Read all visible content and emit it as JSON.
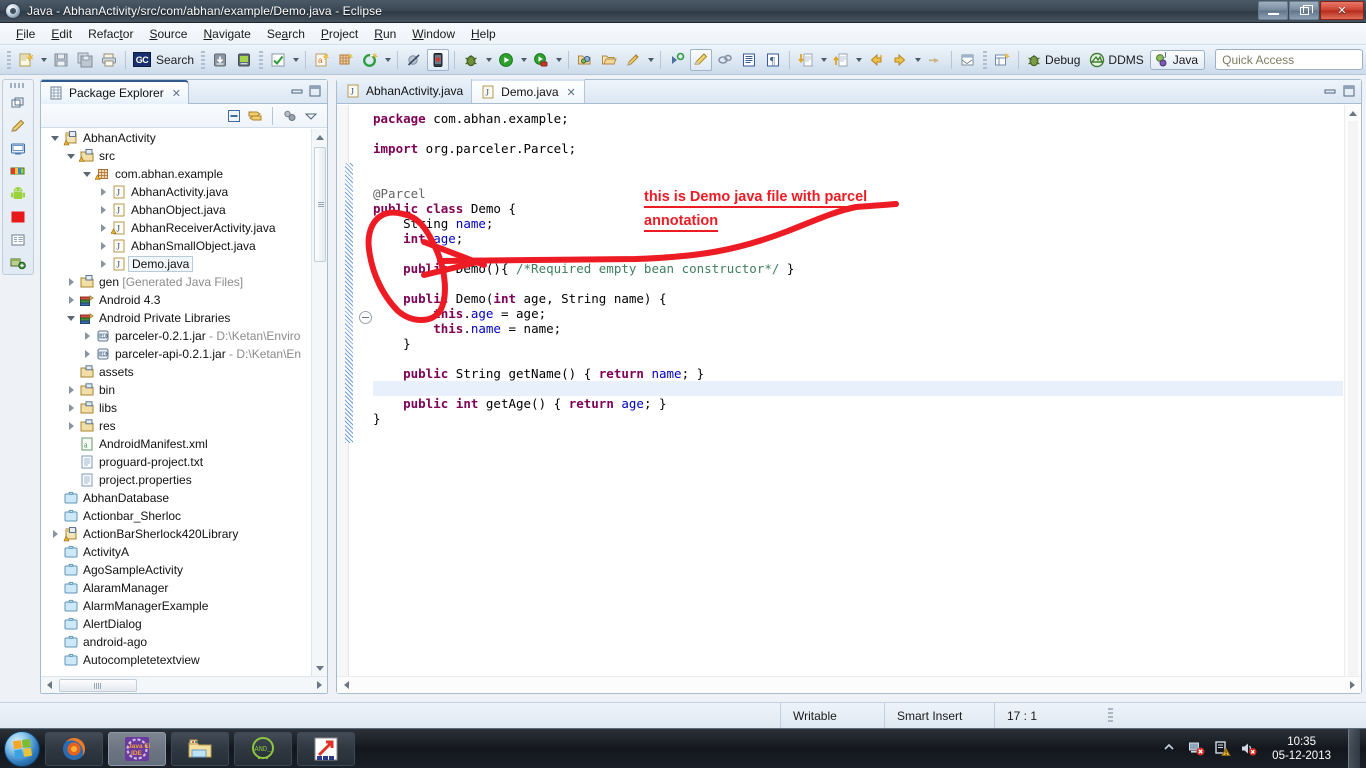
{
  "window": {
    "title": "Java - AbhanActivity/src/com/abhan/example/Demo.java - Eclipse",
    "icon": "eclipse-icon",
    "minimize_label": "Minimize",
    "restore_label": "Restore",
    "close_label": "Close"
  },
  "menubar": {
    "items": [
      {
        "label": "File",
        "mnemonic": "F"
      },
      {
        "label": "Edit",
        "mnemonic": "E"
      },
      {
        "label": "Refactor",
        "mnemonic": "t"
      },
      {
        "label": "Source",
        "mnemonic": "S"
      },
      {
        "label": "Navigate",
        "mnemonic": "N"
      },
      {
        "label": "Search",
        "mnemonic": "a"
      },
      {
        "label": "Project",
        "mnemonic": "P"
      },
      {
        "label": "Run",
        "mnemonic": "R"
      },
      {
        "label": "Window",
        "mnemonic": "W"
      },
      {
        "label": "Help",
        "mnemonic": "H"
      }
    ]
  },
  "toolbar": {
    "search_label": "Search",
    "gc_badge": "GC",
    "items": [
      {
        "name": "new-wizard-icon"
      },
      {
        "name": "save-icon"
      },
      {
        "name": "save-all-icon"
      },
      {
        "name": "print-icon"
      },
      {
        "name": "gc-icon"
      },
      {
        "name": "android-download-icon"
      },
      {
        "name": "android-sdk-manager-icon"
      },
      {
        "name": "check-icon"
      },
      {
        "name": "new-android-project-icon"
      },
      {
        "name": "new-android-xml-icon"
      },
      {
        "name": "new-icon"
      },
      {
        "name": "skip-breakpoints-icon"
      },
      {
        "name": "device-icon"
      },
      {
        "name": "debug-icon"
      },
      {
        "name": "run-icon"
      },
      {
        "name": "run-external-icon"
      },
      {
        "name": "open-type-icon"
      },
      {
        "name": "open-task-icon"
      },
      {
        "name": "marker-icon"
      },
      {
        "name": "next-annotation-icon"
      },
      {
        "name": "toggle-mark-occurrences-icon"
      },
      {
        "name": "link-icon"
      },
      {
        "name": "show-whitespace-icon"
      },
      {
        "name": "pilcrow-icon"
      },
      {
        "name": "next-edit-position-icon"
      },
      {
        "name": "previous-edit-position-icon"
      },
      {
        "name": "back-icon"
      },
      {
        "name": "forward-icon"
      },
      {
        "name": "new-window-icon"
      }
    ]
  },
  "perspectives": {
    "open_label": "Open Perspective",
    "items": [
      {
        "label": "Debug",
        "icon": "debug-perspective-icon",
        "active": false
      },
      {
        "label": "DDMS",
        "icon": "ddms-perspective-icon",
        "active": false
      },
      {
        "label": "Java",
        "icon": "java-perspective-icon",
        "active": true
      }
    ]
  },
  "quick_access": {
    "placeholder": "Quick Access",
    "value": ""
  },
  "fastbar": {
    "items": [
      {
        "name": "restore-icon"
      },
      {
        "name": "pen-icon"
      },
      {
        "name": "console-icon"
      },
      {
        "name": "logcat-icon"
      },
      {
        "name": "android-icon"
      },
      {
        "name": "stop-icon"
      },
      {
        "name": "outline-icon"
      },
      {
        "name": "package-explorer-icon"
      }
    ]
  },
  "package_explorer": {
    "tab_label": "Package Explorer",
    "tab_icon": "package-explorer-icon",
    "close_label": "Close",
    "toolbar": [
      {
        "name": "collapse-all-icon"
      },
      {
        "name": "link-with-editor-icon"
      },
      {
        "name": "focus-on-active-task-icon"
      },
      {
        "name": "view-menu-icon"
      }
    ],
    "minimize_label": "Minimize",
    "maximize_label": "Maximize",
    "tree": [
      {
        "label": "AbhanActivity",
        "indent": 0,
        "twisty": "open",
        "icon": "java-project-warning-icon",
        "selected": false
      },
      {
        "label": "src",
        "indent": 1,
        "twisty": "open",
        "icon": "source-folder-warning-icon",
        "selected": false
      },
      {
        "label": "com.abhan.example",
        "indent": 2,
        "twisty": "open",
        "icon": "package-warning-icon",
        "selected": false
      },
      {
        "label": "AbhanActivity.java",
        "indent": 3,
        "twisty": "closed",
        "icon": "java-file-icon",
        "selected": false
      },
      {
        "label": "AbhanObject.java",
        "indent": 3,
        "twisty": "closed",
        "icon": "java-file-icon",
        "selected": false
      },
      {
        "label": "AbhanReceiverActivity.java",
        "indent": 3,
        "twisty": "closed",
        "icon": "java-file-warning-icon",
        "selected": false
      },
      {
        "label": "AbhanSmallObject.java",
        "indent": 3,
        "twisty": "closed",
        "icon": "java-file-icon",
        "selected": false
      },
      {
        "label": "Demo.java",
        "indent": 3,
        "twisty": "closed",
        "icon": "java-file-icon",
        "selected": true
      },
      {
        "label": "gen",
        "sublabel": " [Generated Java Files]",
        "indent": 1,
        "twisty": "closed",
        "icon": "source-folder-icon",
        "selected": false
      },
      {
        "label": "Android 4.3",
        "indent": 1,
        "twisty": "closed",
        "icon": "library-icon",
        "selected": false
      },
      {
        "label": "Android Private Libraries",
        "indent": 1,
        "twisty": "open",
        "icon": "library-icon",
        "selected": false
      },
      {
        "label": "parceler-0.2.1.jar",
        "sublabel": " - D:\\Ketan\\Enviro",
        "indent": 2,
        "twisty": "closed",
        "icon": "jar-icon",
        "selected": false
      },
      {
        "label": "parceler-api-0.2.1.jar",
        "sublabel": " - D:\\Ketan\\En",
        "indent": 2,
        "twisty": "closed",
        "icon": "jar-icon",
        "selected": false
      },
      {
        "label": "assets",
        "indent": 1,
        "twisty": "none",
        "icon": "folder-icon",
        "selected": false
      },
      {
        "label": "bin",
        "indent": 1,
        "twisty": "closed",
        "icon": "folder-icon",
        "selected": false
      },
      {
        "label": "libs",
        "indent": 1,
        "twisty": "closed",
        "icon": "folder-icon",
        "selected": false
      },
      {
        "label": "res",
        "indent": 1,
        "twisty": "closed",
        "icon": "folder-icon",
        "selected": false
      },
      {
        "label": "AndroidManifest.xml",
        "indent": 1,
        "twisty": "none",
        "icon": "xml-file-icon",
        "selected": false
      },
      {
        "label": "proguard-project.txt",
        "indent": 1,
        "twisty": "none",
        "icon": "text-file-icon",
        "selected": false
      },
      {
        "label": "project.properties",
        "indent": 1,
        "twisty": "none",
        "icon": "text-file-icon",
        "selected": false
      },
      {
        "label": "AbhanDatabase",
        "indent": 0,
        "twisty": "none",
        "icon": "closed-project-icon",
        "selected": false
      },
      {
        "label": "Actionbar_Sherloc",
        "indent": 0,
        "twisty": "none",
        "icon": "closed-project-icon",
        "selected": false
      },
      {
        "label": "ActionBarSherlock420Library",
        "indent": 0,
        "twisty": "closed",
        "icon": "java-project-warning-icon",
        "selected": false
      },
      {
        "label": "ActivityA",
        "indent": 0,
        "twisty": "none",
        "icon": "closed-project-icon",
        "selected": false
      },
      {
        "label": "AgoSampleActivity",
        "indent": 0,
        "twisty": "none",
        "icon": "closed-project-icon",
        "selected": false
      },
      {
        "label": "AlaramManager",
        "indent": 0,
        "twisty": "none",
        "icon": "closed-project-icon",
        "selected": false
      },
      {
        "label": "AlarmManagerExample",
        "indent": 0,
        "twisty": "none",
        "icon": "closed-project-icon",
        "selected": false
      },
      {
        "label": "AlertDialog",
        "indent": 0,
        "twisty": "none",
        "icon": "closed-project-icon",
        "selected": false
      },
      {
        "label": "android-ago",
        "indent": 0,
        "twisty": "none",
        "icon": "closed-project-icon",
        "selected": false
      },
      {
        "label": "Autocompletetextview",
        "indent": 0,
        "twisty": "none",
        "icon": "closed-project-icon",
        "selected": false
      }
    ]
  },
  "editor": {
    "tabs": [
      {
        "label": "AbhanActivity.java",
        "icon": "java-file-icon",
        "active": false,
        "closeable": false
      },
      {
        "label": "Demo.java",
        "icon": "java-file-icon",
        "active": true,
        "closeable": true
      }
    ],
    "minimize_label": "Minimize",
    "maximize_label": "Maximize",
    "code_lines": [
      {
        "tokens": [
          {
            "t": "package",
            "c": "k"
          },
          {
            "t": " com.abhan.example;",
            "c": ""
          }
        ]
      },
      {
        "tokens": []
      },
      {
        "tokens": [
          {
            "t": "import",
            "c": "k"
          },
          {
            "t": " org.parceler.Parcel;",
            "c": ""
          }
        ]
      },
      {
        "tokens": []
      },
      {
        "tokens": []
      },
      {
        "tokens": [
          {
            "t": "@Parcel",
            "c": "an"
          }
        ]
      },
      {
        "tokens": [
          {
            "t": "public",
            "c": "k"
          },
          {
            "t": " ",
            "c": ""
          },
          {
            "t": "class",
            "c": "k"
          },
          {
            "t": " Demo {",
            "c": ""
          }
        ]
      },
      {
        "tokens": [
          {
            "t": "    String ",
            "c": ""
          },
          {
            "t": "name",
            "c": "f"
          },
          {
            "t": ";",
            "c": ""
          }
        ]
      },
      {
        "tokens": [
          {
            "t": "    ",
            "c": ""
          },
          {
            "t": "int",
            "c": "k"
          },
          {
            "t": " ",
            "c": ""
          },
          {
            "t": "age",
            "c": "f"
          },
          {
            "t": ";",
            "c": ""
          }
        ]
      },
      {
        "tokens": []
      },
      {
        "tokens": [
          {
            "t": "    ",
            "c": ""
          },
          {
            "t": "public",
            "c": "k"
          },
          {
            "t": " Demo(){ ",
            "c": ""
          },
          {
            "t": "/*Required empty bean constructor*/",
            "c": "cm"
          },
          {
            "t": " }",
            "c": ""
          }
        ]
      },
      {
        "tokens": []
      },
      {
        "tokens": [
          {
            "t": "    ",
            "c": ""
          },
          {
            "t": "public",
            "c": "k"
          },
          {
            "t": " Demo(",
            "c": ""
          },
          {
            "t": "int",
            "c": "k"
          },
          {
            "t": " age, String name) {",
            "c": ""
          }
        ]
      },
      {
        "tokens": [
          {
            "t": "        ",
            "c": ""
          },
          {
            "t": "this",
            "c": "k"
          },
          {
            "t": ".",
            "c": ""
          },
          {
            "t": "age",
            "c": "f"
          },
          {
            "t": " = age;",
            "c": ""
          }
        ]
      },
      {
        "tokens": [
          {
            "t": "        ",
            "c": ""
          },
          {
            "t": "this",
            "c": "k"
          },
          {
            "t": ".",
            "c": ""
          },
          {
            "t": "name",
            "c": "f"
          },
          {
            "t": " = name;",
            "c": ""
          }
        ]
      },
      {
        "tokens": [
          {
            "t": "    }",
            "c": ""
          }
        ]
      },
      {
        "tokens": []
      },
      {
        "tokens": [
          {
            "t": "    ",
            "c": ""
          },
          {
            "t": "public",
            "c": "k"
          },
          {
            "t": " String getName() { ",
            "c": ""
          },
          {
            "t": "return",
            "c": "k"
          },
          {
            "t": " ",
            "c": ""
          },
          {
            "t": "name",
            "c": "f"
          },
          {
            "t": "; }",
            "c": ""
          }
        ]
      },
      {
        "tokens": []
      },
      {
        "tokens": [
          {
            "t": "    ",
            "c": ""
          },
          {
            "t": "public",
            "c": "k"
          },
          {
            "t": " ",
            "c": ""
          },
          {
            "t": "int",
            "c": "k"
          },
          {
            "t": " getAge() { ",
            "c": ""
          },
          {
            "t": "return",
            "c": "k"
          },
          {
            "t": " ",
            "c": ""
          },
          {
            "t": "age",
            "c": "f"
          },
          {
            "t": "; }",
            "c": ""
          }
        ]
      },
      {
        "tokens": [
          {
            "t": "}",
            "c": ""
          }
        ]
      }
    ]
  },
  "annotation": {
    "line1": "this is Demo java file with parcel",
    "line2": "annotation",
    "color": "#ed1c24",
    "shapes": "red-circle-around-parcel-annotation-with-arrow"
  },
  "statusbar": {
    "writable": "Writable",
    "insert_mode": "Smart Insert",
    "position": "17 : 1"
  },
  "taskbar": {
    "start_label": "Start",
    "tasks": [
      {
        "name": "firefox-taskbar-button",
        "active": false
      },
      {
        "name": "eclipse-javaee-taskbar-button",
        "active": true
      },
      {
        "name": "explorer-taskbar-button",
        "active": false
      },
      {
        "name": "android-emulator-taskbar-button",
        "active": false
      },
      {
        "name": "app-taskbar-button",
        "active": false
      }
    ],
    "tray": [
      {
        "name": "show-hidden-icons-arrow"
      },
      {
        "name": "network-error-icon"
      },
      {
        "name": "action-center-warning-icon"
      },
      {
        "name": "volume-muted-icon"
      }
    ],
    "time": "10:35",
    "date": "05-12-2013"
  }
}
